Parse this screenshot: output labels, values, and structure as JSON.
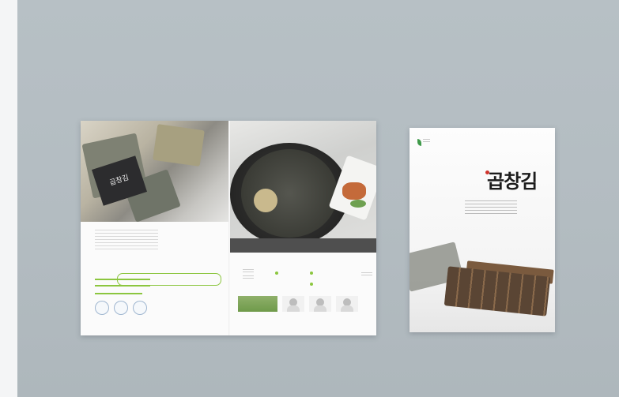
{
  "scene": {
    "background_color": "#b4bdc2",
    "items": [
      "spread-brochure",
      "cover-brochure"
    ]
  },
  "spread": {
    "left_photo_tag": "곱창김",
    "left_heading": "",
    "accent_color": "#8cc63f",
    "strip_color": "#4f4f4f"
  },
  "cover": {
    "brand_text": "곱창김",
    "brand_dot_color": "#d0342c",
    "logo_color": "#3f9a4a"
  }
}
